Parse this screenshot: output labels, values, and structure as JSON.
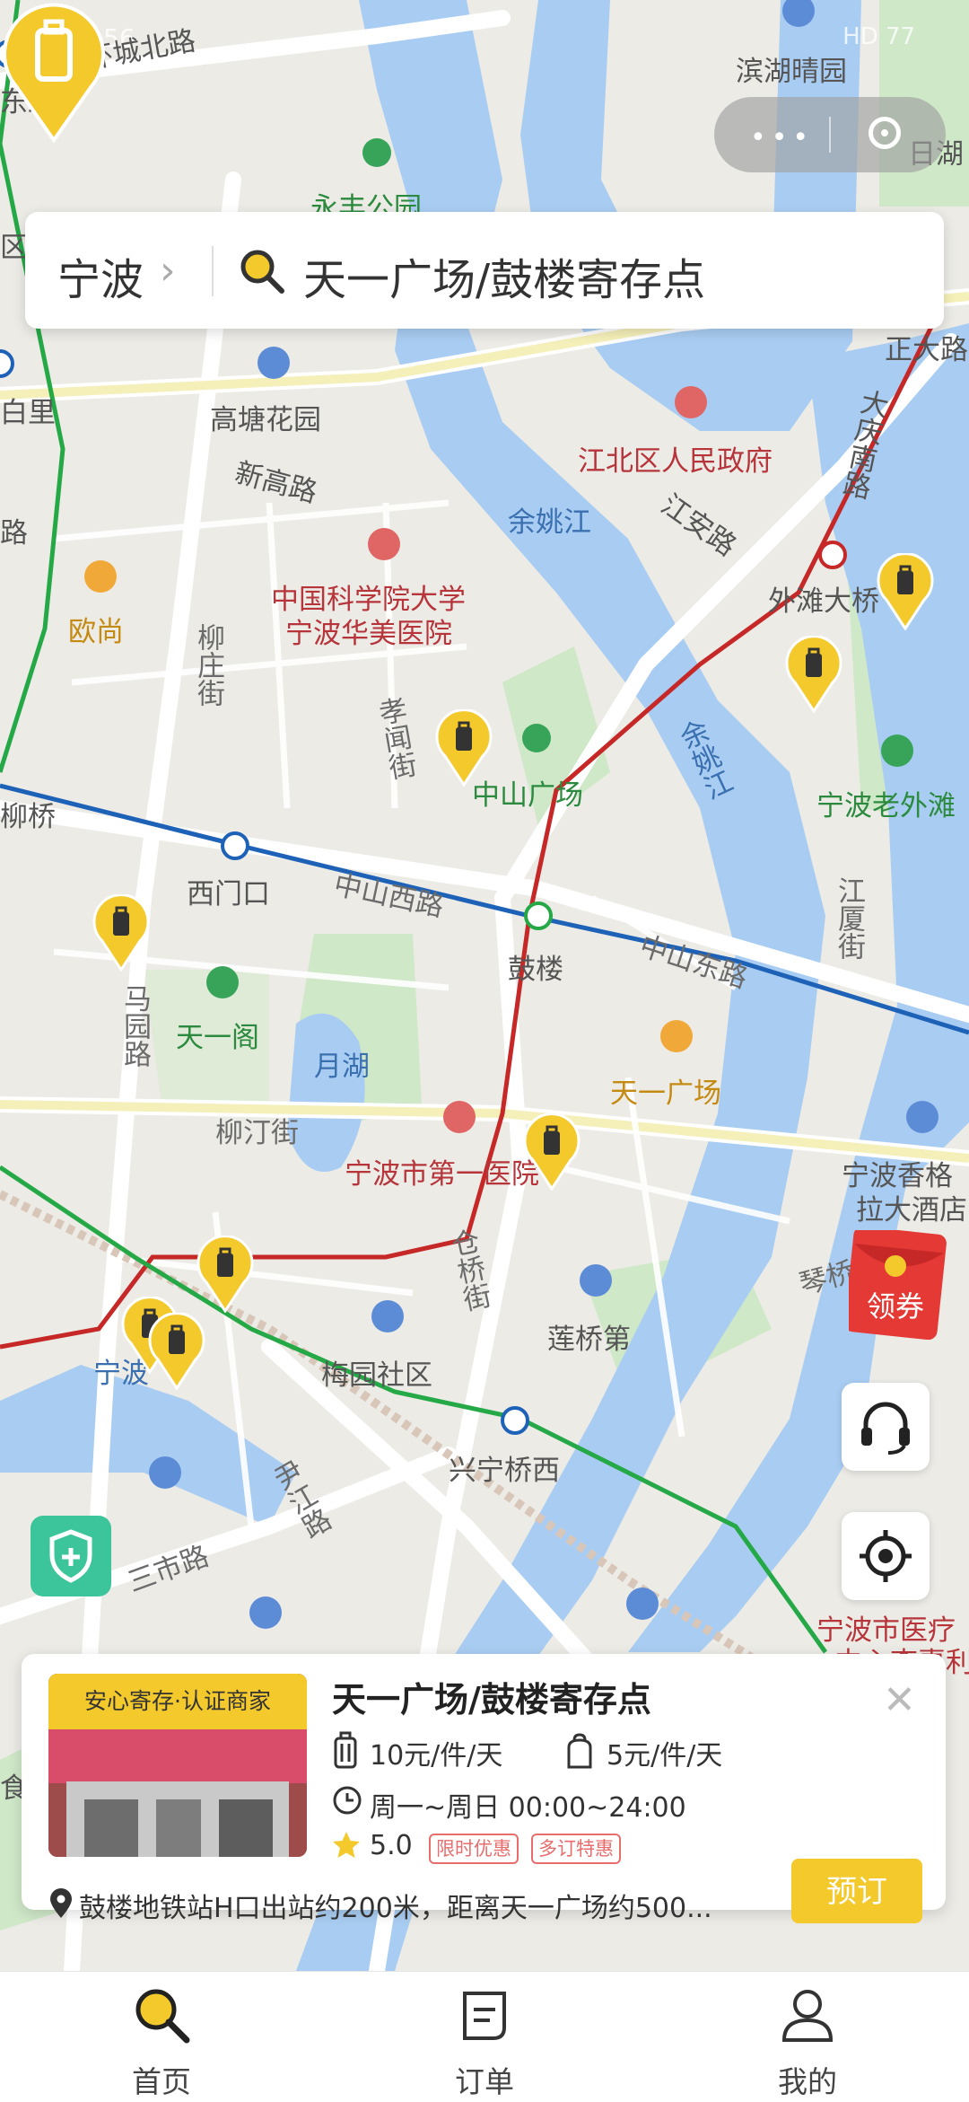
{
  "status_bar": {
    "time": "10:56",
    "right": "HD 77"
  },
  "map": {
    "labels": {
      "huancheng": "环城北路",
      "dong": "东路",
      "binhu": "滨湖晴园",
      "rihu": "日湖",
      "yongfeng": "永丰公园",
      "qu": "区",
      "zhengda": "正大路",
      "gaotang": "高塘花园",
      "xingao": "新高路",
      "jiangbei": "江北区人民政府",
      "bailu": "白里",
      "lu": "路",
      "yuyao1": "余姚江",
      "jiangan": "江安路",
      "daqingnan": "大庆南路",
      "zhongke1": "中国科学院大学",
      "zhongke2": "宁波华美医院",
      "ouzhang": "欧尚",
      "liuzhuang": "柳庄街",
      "xiaowen": "孝闻街",
      "waitan": "外滩大桥",
      "yuyao2": "余姚江",
      "zhongshan_sq": "中山广场",
      "laowaitan": "宁波老外滩",
      "liuqiao": "柳桥",
      "ximenkou": "西门口",
      "zhongshanxi": "中山西路",
      "gulou": "鼓楼",
      "zhongshandong": "中山东路",
      "jiangxia": "江厦街",
      "tianyige": "天一阁",
      "malu": "马园路",
      "yuehu": "月湖",
      "tianyi_sq": "天一广场",
      "liuting": "柳汀街",
      "diyi": "宁波市第一医院",
      "shangri1": "宁波香格",
      "shangri2": "拉大酒店",
      "cangqiao": "仓桥街",
      "qinqiao": "琴桥",
      "ningbo": "宁波",
      "lianqiao": "莲桥第",
      "meiyuan": "梅园社区",
      "xingning": "兴宁桥西",
      "yinjiang": "尹江路",
      "sanshi": "三市路",
      "yiliao1": "宁波市医疗",
      "yiliao2": "中心李惠利",
      "shi": "食"
    }
  },
  "search": {
    "city": "宁波",
    "placeholder": "天一广场/鼓楼寄存点"
  },
  "side": {
    "coupon_label": "领券"
  },
  "card": {
    "badge": "安心寄存·认证商家",
    "name": "天一广场/鼓楼寄存点",
    "price_large": "10元/件/天",
    "price_small": "5元/件/天",
    "hours": "周一~周日 00:00~24:00",
    "rating": "5.0",
    "tag1": "限时优惠",
    "tag2": "多订特惠",
    "address": "鼓楼地铁站H口出站约200米，距离天一广场约500...",
    "book_label": "预订"
  },
  "tabs": [
    {
      "label": "首页",
      "icon": "search-icon"
    },
    {
      "label": "订单",
      "icon": "order-icon"
    },
    {
      "label": "我的",
      "icon": "user-icon"
    }
  ],
  "colors": {
    "accent": "#f3c92c",
    "metro_red": "#c62828",
    "metro_blue": "#1e62b8",
    "metro_green": "#25a846",
    "river": "#9fc6f0"
  }
}
